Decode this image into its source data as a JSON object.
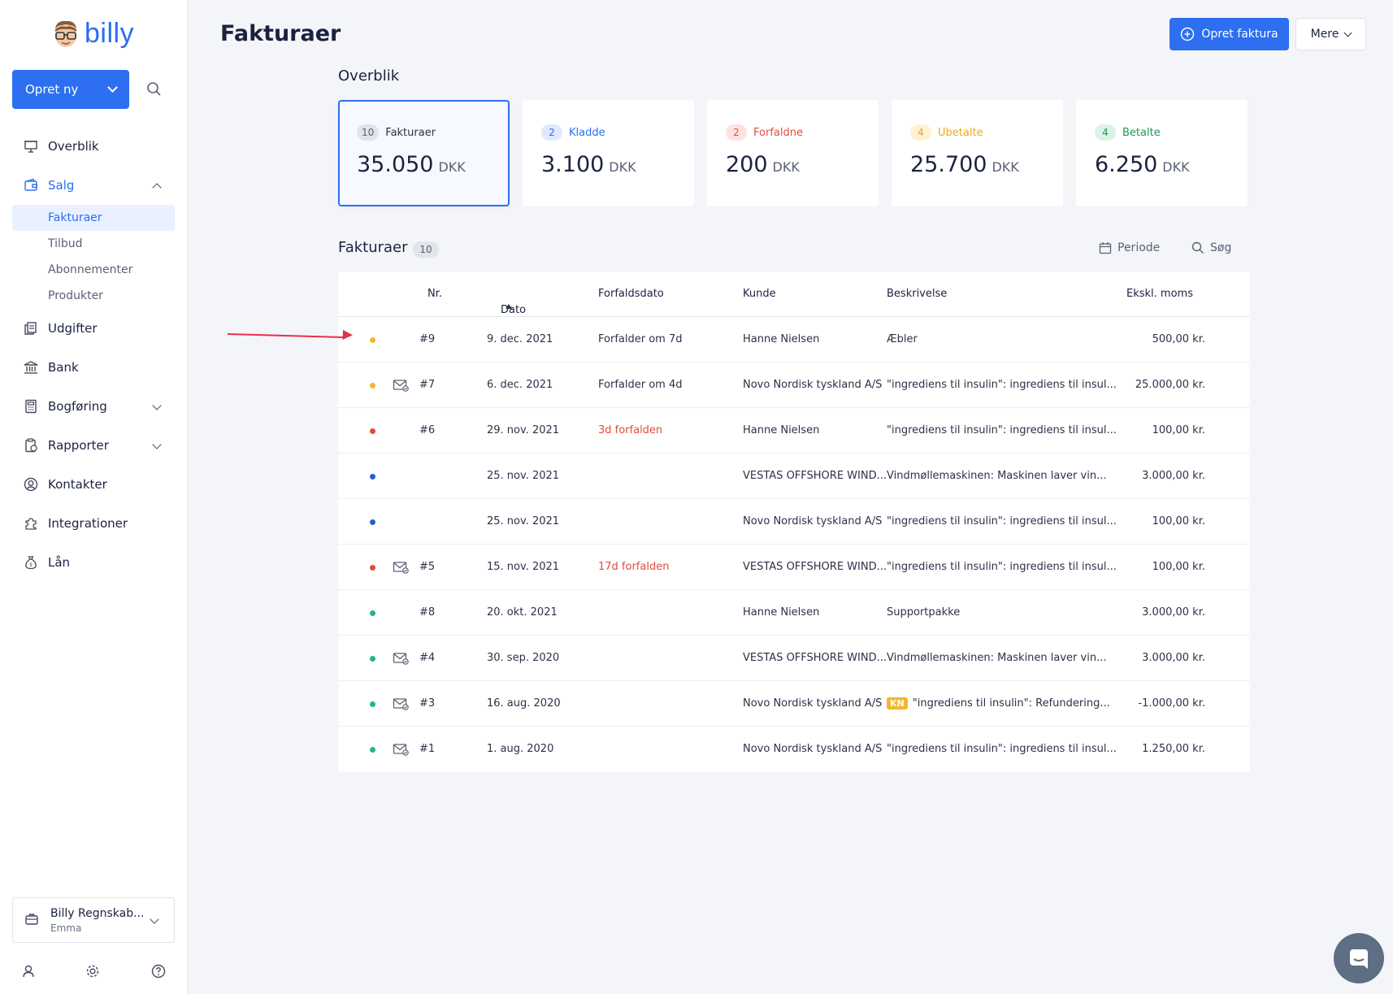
{
  "sidebar": {
    "logo_text": "billy",
    "create_label": "Opret ny",
    "items": [
      {
        "label": "Overblik"
      },
      {
        "label": "Salg"
      },
      {
        "label": "Udgifter"
      },
      {
        "label": "Bank"
      },
      {
        "label": "Bogføring"
      },
      {
        "label": "Rapporter"
      },
      {
        "label": "Kontakter"
      },
      {
        "label": "Integrationer"
      },
      {
        "label": "Lån"
      }
    ],
    "sub_items": [
      {
        "label": "Fakturaer"
      },
      {
        "label": "Tilbud"
      },
      {
        "label": "Abonnementer"
      },
      {
        "label": "Produkter"
      }
    ],
    "account": {
      "name": "Billy Regnskab...",
      "user": "Emma"
    }
  },
  "header": {
    "title": "Fakturaer",
    "primary_button": "Opret faktura",
    "secondary_button": "Mere"
  },
  "overview": {
    "title": "Overblik",
    "cards": [
      {
        "count": "10",
        "label": "Fakturaer",
        "amount": "35.050",
        "unit": "DKK",
        "color": "#5a6075",
        "badge_bg": "#e1e4ea"
      },
      {
        "count": "2",
        "label": "Kladde",
        "amount": "3.100",
        "unit": "DKK",
        "color": "#2a6ef0",
        "badge_bg": "#dfe9fd"
      },
      {
        "count": "2",
        "label": "Forfaldne",
        "amount": "200",
        "unit": "DKK",
        "color": "#e24b3b",
        "badge_bg": "#fde3e0"
      },
      {
        "count": "4",
        "label": "Ubetalte",
        "amount": "25.700",
        "unit": "DKK",
        "color": "#e9a822",
        "badge_bg": "#fdf2d2"
      },
      {
        "count": "4",
        "label": "Betalte",
        "amount": "6.250",
        "unit": "DKK",
        "color": "#1a9a5c",
        "badge_bg": "#dbf3e6"
      }
    ]
  },
  "invoices": {
    "title": "Fakturaer",
    "count": "10",
    "period_label": "Periode",
    "search_label": "Søg",
    "columns": {
      "nr": "Nr.",
      "date": "Dato",
      "due": "Forfaldsdato",
      "customer": "Kunde",
      "description": "Beskrivelse",
      "amount": "Ekskl. moms"
    },
    "rows": [
      {
        "status": "#f2b731",
        "mail": false,
        "nr": "#9",
        "date": "9. dec. 2021",
        "due": "Forfalder om 7d",
        "due_red": false,
        "customer": "Hanne Nielsen",
        "kn": "",
        "description": "Æbler",
        "amount": "500,00 kr."
      },
      {
        "status": "#f2b731",
        "mail": true,
        "nr": "#7",
        "date": "6. dec. 2021",
        "due": "Forfalder om 4d",
        "due_red": false,
        "customer": "Novo Nordisk tyskland A/S",
        "kn": "",
        "description": "\"ingrediens til insulin\": ingrediens til insul...",
        "amount": "25.000,00 kr."
      },
      {
        "status": "#e24b3b",
        "mail": false,
        "nr": "#6",
        "date": "29. nov. 2021",
        "due": "3d forfalden",
        "due_red": true,
        "customer": "Hanne Nielsen",
        "kn": "",
        "description": "\"ingrediens til insulin\": ingrediens til insul...",
        "amount": "100,00 kr."
      },
      {
        "status": "#2a5bd7",
        "mail": false,
        "nr": "",
        "date": "25. nov. 2021",
        "due": "",
        "due_red": false,
        "customer": "VESTAS OFFSHORE WIND...",
        "kn": "",
        "description": "Vindmøllemaskinen: Maskinen laver vin...",
        "amount": "3.000,00 kr."
      },
      {
        "status": "#2a5bd7",
        "mail": false,
        "nr": "",
        "date": "25. nov. 2021",
        "due": "",
        "due_red": false,
        "customer": "Novo Nordisk tyskland A/S",
        "kn": "",
        "description": "\"ingrediens til insulin\": ingrediens til insul...",
        "amount": "100,00 kr."
      },
      {
        "status": "#e24b3b",
        "mail": true,
        "nr": "#5",
        "date": "15. nov. 2021",
        "due": "17d forfalden",
        "due_red": true,
        "customer": "VESTAS OFFSHORE WIND...",
        "kn": "",
        "description": "\"ingrediens til insulin\": ingrediens til insul...",
        "amount": "100,00 kr."
      },
      {
        "status": "#1fba7a",
        "mail": false,
        "nr": "#8",
        "date": "20. okt. 2021",
        "due": "",
        "due_red": false,
        "customer": "Hanne Nielsen",
        "kn": "",
        "description": "Supportpakke",
        "amount": "3.000,00 kr."
      },
      {
        "status": "#1fba7a",
        "mail": true,
        "nr": "#4",
        "date": "30. sep. 2020",
        "due": "",
        "due_red": false,
        "customer": "VESTAS OFFSHORE WIND...",
        "kn": "",
        "description": "Vindmøllemaskinen: Maskinen laver vin...",
        "amount": "3.000,00 kr."
      },
      {
        "status": "#1fba7a",
        "mail": true,
        "nr": "#3",
        "date": "16. aug. 2020",
        "due": "",
        "due_red": false,
        "customer": "Novo Nordisk tyskland A/S",
        "kn": "KN",
        "description": "\"ingrediens til insulin\": Refundering...",
        "amount": "-1.000,00 kr."
      },
      {
        "status": "#1fba7a",
        "mail": true,
        "nr": "#1",
        "date": "1. aug. 2020",
        "due": "",
        "due_red": false,
        "customer": "Novo Nordisk tyskland A/S",
        "kn": "",
        "description": "\"ingrediens til insulin\": ingrediens til insul...",
        "amount": "1.250,00 kr."
      }
    ]
  }
}
